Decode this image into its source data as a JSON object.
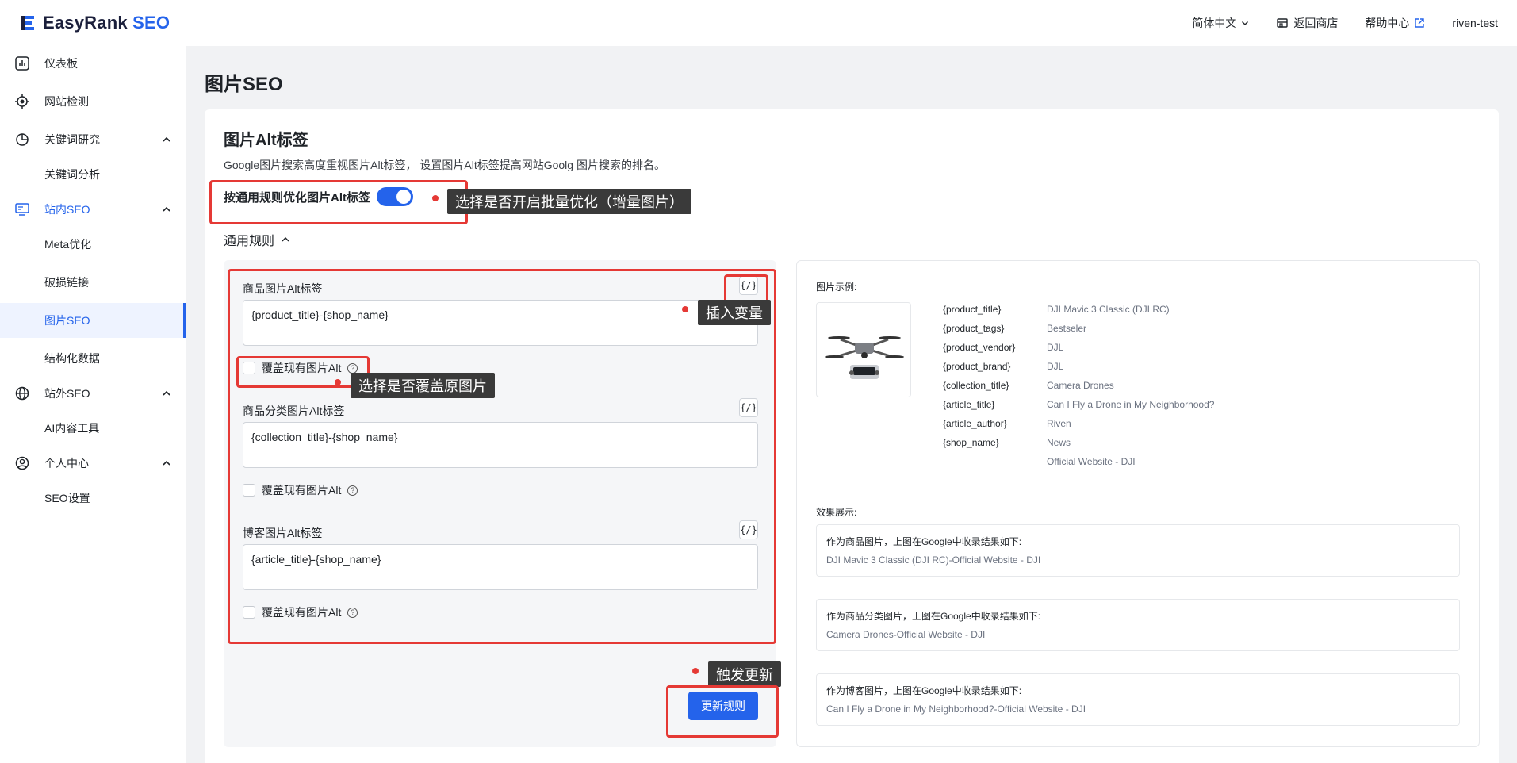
{
  "app": {
    "brand_main": "EasyRank",
    "brand_accent": "SEO",
    "accent_color": "#2463eb"
  },
  "topbar": {
    "language": "简体中文",
    "back_to_store": "返回商店",
    "help_center": "帮助中心",
    "user": "riven-test"
  },
  "sidebar": {
    "items": [
      {
        "label": "仪表板",
        "icon": "dashboard-icon"
      },
      {
        "label": "网站检测",
        "icon": "target-icon"
      },
      {
        "label": "关键词研究",
        "icon": "pie-chart-icon"
      },
      {
        "label": "关键词分析"
      },
      {
        "label": "站内SEO",
        "icon": "monitor-icon"
      },
      {
        "label": "Meta优化"
      },
      {
        "label": "破损链接"
      },
      {
        "label": "图片SEO"
      },
      {
        "label": "结构化数据"
      },
      {
        "label": "站外SEO",
        "icon": "globe-icon"
      },
      {
        "label": "AI内容工具"
      },
      {
        "label": "个人中心",
        "icon": "user-circle-icon"
      },
      {
        "label": "SEO设置"
      }
    ]
  },
  "page": {
    "title": "图片SEO",
    "card_title": "图片Alt标签",
    "card_desc": "Google图片搜索高度重视图片Alt标签， 设置图片Alt标签提高网站Goolg 图片搜索的排名。",
    "toggle_label": "按通用规则优化图片Alt标签",
    "toggle_on": true,
    "rules_title": "通用规则"
  },
  "fields": [
    {
      "label": "商品图片Alt标签",
      "value": "{product_title}-{shop_name}",
      "overwrite_label": "覆盖现有图片Alt"
    },
    {
      "label": "商品分类图片Alt标签",
      "value": "{collection_title}-{shop_name}",
      "overwrite_label": "覆盖现有图片Alt"
    },
    {
      "label": "博客图片Alt标签",
      "value": "{article_title}-{shop_name}",
      "overwrite_label": "覆盖现有图片Alt"
    }
  ],
  "var_button": "{/}",
  "update_button": "更新规则",
  "example": {
    "label": "图片示例:",
    "vars": [
      {
        "key": "{product_title}",
        "value": "DJI Mavic 3 Classic (DJI RC)"
      },
      {
        "key": "{product_tags}",
        "value": "Bestseler"
      },
      {
        "key": "{product_vendor}",
        "value": "DJL"
      },
      {
        "key": "{product_brand}",
        "value": "DJL"
      },
      {
        "key": "{collection_title}",
        "value": "Camera Drones"
      },
      {
        "key": "{article_title}",
        "value": "Can I Fly a Drone in My Neighborhood?"
      },
      {
        "key": "{article_author}",
        "value": "Riven"
      },
      {
        "key": "{shop_name}",
        "value": "News"
      },
      {
        "key": "",
        "value": "Official Website - DJI"
      }
    ],
    "effect_label": "效果展示:",
    "results": [
      {
        "title": "作为商品图片，上图在Google中收录结果如下:",
        "value": "DJI Mavic 3 Classic (DJI RC)-Official Website - DJI"
      },
      {
        "title": "作为商品分类图片，上图在Google中收录结果如下:",
        "value": "Camera Drones-Official Website - DJI"
      },
      {
        "title": "作为博客图片，上图在Google中收录结果如下:",
        "value": "Can I Fly a Drone in My Neighborhood?-Official Website - DJI"
      }
    ]
  },
  "annotations": {
    "toggle_tip": "选择是否开启批量优化（增量图片）",
    "var_tip": "插入变量",
    "overwrite_tip": "选择是否覆盖原图片",
    "update_tip": "触发更新",
    "annotation_color": "#e53935"
  }
}
